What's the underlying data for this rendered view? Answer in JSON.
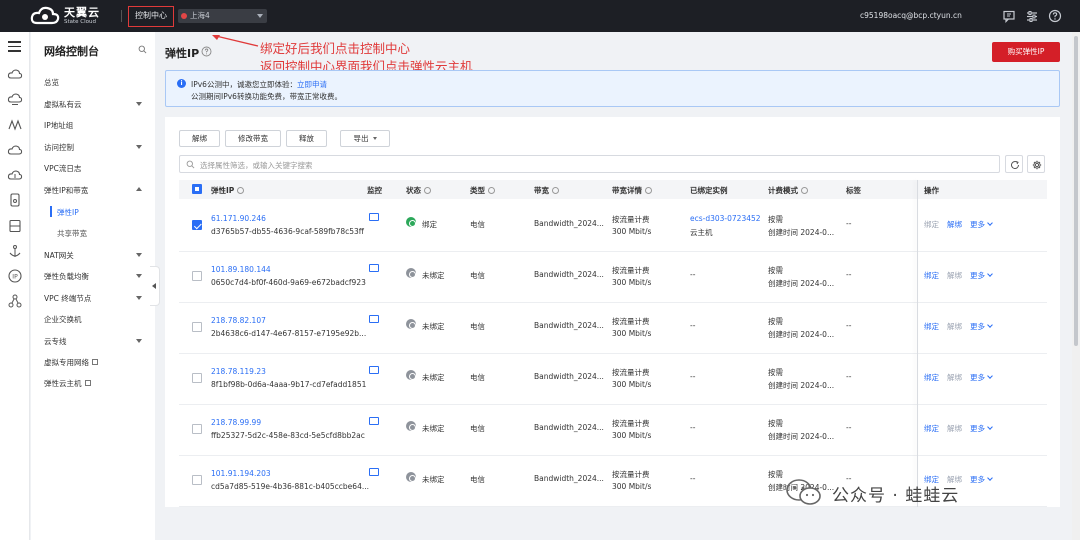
{
  "brand": {
    "name_cn": "天翼云",
    "name_en": "State Cloud"
  },
  "topbar": {
    "console_label": "控制中心",
    "region": "上海4",
    "user_email": "c95198oacq@bcp.ctyun.cn"
  },
  "sidenav": {
    "title": "网络控制台",
    "items": [
      {
        "label": "总览"
      },
      {
        "label": "虚拟私有云"
      },
      {
        "label": "IP地址组"
      },
      {
        "label": "访问控制"
      },
      {
        "label": "VPC流日志"
      },
      {
        "label": "弹性IP和带宽"
      },
      {
        "label": "弹性IP"
      },
      {
        "label": "共享带宽"
      },
      {
        "label": "NAT网关"
      },
      {
        "label": "弹性负载均衡"
      },
      {
        "label": "VPC 终端节点"
      },
      {
        "label": "企业交换机"
      },
      {
        "label": "云专线"
      },
      {
        "label": "虚拟专用网络"
      },
      {
        "label": "弹性云主机"
      }
    ]
  },
  "page": {
    "title": "弹性IP",
    "buy_button": "购买弹性IP",
    "annotation_line1": "绑定好后我们点击控制中心",
    "annotation_line2": "返回控制中心界面我们点击弹性云主机"
  },
  "notice": {
    "line1_text": "IPv6公测中，诚邀您立即体验：",
    "line1_link": "立即申请",
    "line2_text": "公测期间IPv6转换功能免费，带宽正常收费。"
  },
  "toolbar": {
    "unbind": "解绑",
    "modify_bandwidth": "修改带宽",
    "release": "释放",
    "export": "导出",
    "search_placeholder": "选择属性筛选，或输入关键字搜索"
  },
  "table": {
    "headers": {
      "eip": "弹性IP",
      "monitor": "监控",
      "status": "状态",
      "type": "类型",
      "bandwidth": "带宽",
      "bandwidth_detail": "带宽详情",
      "bound_instance": "已绑定实例",
      "billing": "计费模式",
      "tags": "标签",
      "ops": "操作"
    },
    "op_labels": {
      "bind": "绑定",
      "unbind": "解绑",
      "more": "更多"
    },
    "rows": [
      {
        "ip": "61.171.90.246",
        "id": "d3765b57-db55-4636-9caf-589fb78c53ff",
        "status": "绑定",
        "type": "电信",
        "bandwidth": "Bandwidth_2024...",
        "billing_type": "按流量计费",
        "speed": "300 Mbit/s",
        "instance_id": "ecs-d303-0723452",
        "instance_type": "云主机",
        "mode": "按需",
        "created": "创建时间 2024-0...",
        "tags": "--",
        "checked": true
      },
      {
        "ip": "101.89.180.144",
        "id": "0650c7d4-bf0f-460d-9a69-e672badcf923",
        "status": "未绑定",
        "type": "电信",
        "bandwidth": "Bandwidth_2024...",
        "billing_type": "按流量计费",
        "speed": "300 Mbit/s",
        "instance_id": "--",
        "instance_type": "",
        "mode": "按需",
        "created": "创建时间 2024-0...",
        "tags": "--",
        "checked": false
      },
      {
        "ip": "218.78.82.107",
        "id": "2b4638c6-d147-4e67-8157-e7195e92b...",
        "status": "未绑定",
        "type": "电信",
        "bandwidth": "Bandwidth_2024...",
        "billing_type": "按流量计费",
        "speed": "300 Mbit/s",
        "instance_id": "--",
        "instance_type": "",
        "mode": "按需",
        "created": "创建时间 2024-0...",
        "tags": "--",
        "checked": false
      },
      {
        "ip": "218.78.119.23",
        "id": "8f1bf98b-0d6a-4aaa-9b17-cd7efadd1851",
        "status": "未绑定",
        "type": "电信",
        "bandwidth": "Bandwidth_2024...",
        "billing_type": "按流量计费",
        "speed": "300 Mbit/s",
        "instance_id": "--",
        "instance_type": "",
        "mode": "按需",
        "created": "创建时间 2024-0...",
        "tags": "--",
        "checked": false
      },
      {
        "ip": "218.78.99.99",
        "id": "ffb25327-5d2c-458e-83cd-5e5cfd8bb2ac",
        "status": "未绑定",
        "type": "电信",
        "bandwidth": "Bandwidth_2024...",
        "billing_type": "按流量计费",
        "speed": "300 Mbit/s",
        "instance_id": "--",
        "instance_type": "",
        "mode": "按需",
        "created": "创建时间 2024-0...",
        "tags": "--",
        "checked": false
      },
      {
        "ip": "101.91.194.203",
        "id": "cd5a7d85-519e-4b36-881c-b405ccbe64...",
        "status": "未绑定",
        "type": "电信",
        "bandwidth": "Bandwidth_2024...",
        "billing_type": "按流量计费",
        "speed": "300 Mbit/s",
        "instance_id": "--",
        "instance_type": "",
        "mode": "按需",
        "created": "创建时间 2024-0...",
        "tags": "--",
        "checked": false
      }
    ]
  },
  "watermark": {
    "text": "公众号 · 蛙蛙云"
  },
  "colors": {
    "accent": "#2a6ef5",
    "brand_red": "#d41f28",
    "annotation_red": "#e03a3a",
    "bound_green": "#2ca85a"
  }
}
